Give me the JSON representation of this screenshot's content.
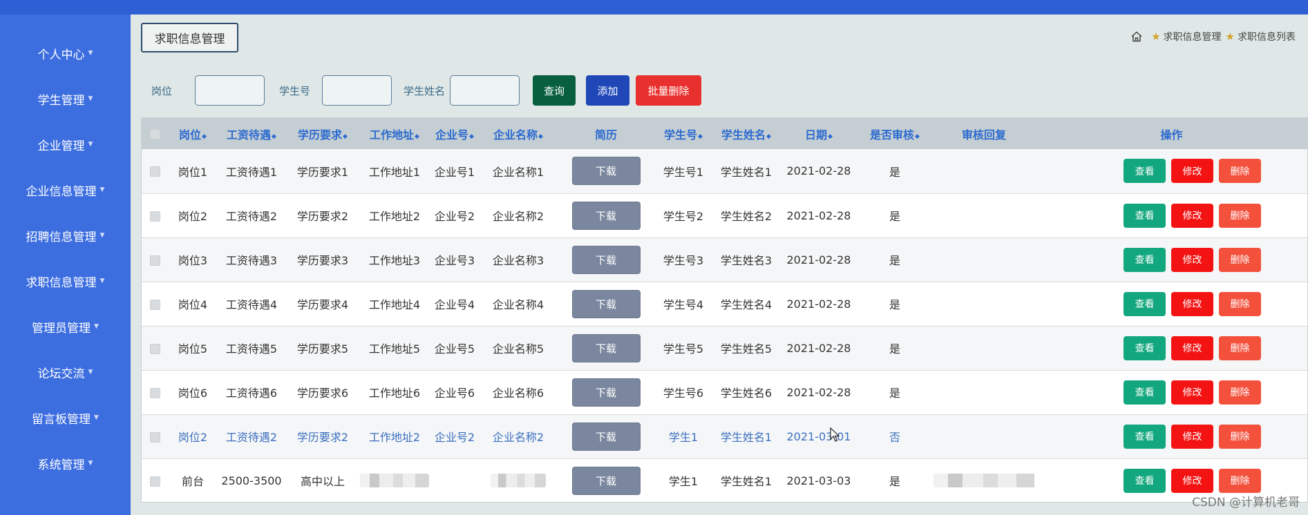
{
  "sidebar": {
    "items": [
      {
        "label": "个人中心"
      },
      {
        "label": "学生管理"
      },
      {
        "label": "企业管理"
      },
      {
        "label": "企业信息管理"
      },
      {
        "label": "招聘信息管理"
      },
      {
        "label": "求职信息管理"
      },
      {
        "label": "管理员管理"
      },
      {
        "label": "论坛交流"
      },
      {
        "label": "留言板管理"
      },
      {
        "label": "系统管理"
      }
    ]
  },
  "header": {
    "title": "求职信息管理",
    "breadcrumb": [
      "求职信息管理",
      "求职信息列表"
    ]
  },
  "search": {
    "label_position": "岗位",
    "label_student_no": "学生号",
    "label_student_name": "学生姓名",
    "value_position": "",
    "value_student_no": "",
    "value_student_name": "",
    "query_label": "查询",
    "add_label": "添加",
    "batch_delete_label": "批量删除"
  },
  "table": {
    "headers": [
      "岗位",
      "工资待遇",
      "学历要求",
      "工作地址",
      "企业号",
      "企业名称",
      "简历",
      "学生号",
      "学生姓名",
      "日期",
      "是否审核",
      "审核回复",
      "操作"
    ],
    "download_label": "下载",
    "view_label": "查看",
    "edit_label": "修改",
    "delete_label": "删除",
    "rows": [
      {
        "position": "岗位1",
        "salary": "工资待遇1",
        "education": "学历要求1",
        "address": "工作地址1",
        "company_no": "企业号1",
        "company_name": "企业名称1",
        "student_no": "学生号1",
        "student_name": "学生姓名1",
        "date": "2021-02-28",
        "reviewed": "是",
        "reply": ""
      },
      {
        "position": "岗位2",
        "salary": "工资待遇2",
        "education": "学历要求2",
        "address": "工作地址2",
        "company_no": "企业号2",
        "company_name": "企业名称2",
        "student_no": "学生号2",
        "student_name": "学生姓名2",
        "date": "2021-02-28",
        "reviewed": "是",
        "reply": ""
      },
      {
        "position": "岗位3",
        "salary": "工资待遇3",
        "education": "学历要求3",
        "address": "工作地址3",
        "company_no": "企业号3",
        "company_name": "企业名称3",
        "student_no": "学生号3",
        "student_name": "学生姓名3",
        "date": "2021-02-28",
        "reviewed": "是",
        "reply": ""
      },
      {
        "position": "岗位4",
        "salary": "工资待遇4",
        "education": "学历要求4",
        "address": "工作地址4",
        "company_no": "企业号4",
        "company_name": "企业名称4",
        "student_no": "学生号4",
        "student_name": "学生姓名4",
        "date": "2021-02-28",
        "reviewed": "是",
        "reply": ""
      },
      {
        "position": "岗位5",
        "salary": "工资待遇5",
        "education": "学历要求5",
        "address": "工作地址5",
        "company_no": "企业号5",
        "company_name": "企业名称5",
        "student_no": "学生号5",
        "student_name": "学生姓名5",
        "date": "2021-02-28",
        "reviewed": "是",
        "reply": ""
      },
      {
        "position": "岗位6",
        "salary": "工资待遇6",
        "education": "学历要求6",
        "address": "工作地址6",
        "company_no": "企业号6",
        "company_name": "企业名称6",
        "student_no": "学生号6",
        "student_name": "学生姓名6",
        "date": "2021-02-28",
        "reviewed": "是",
        "reply": ""
      },
      {
        "position": "岗位2",
        "salary": "工资待遇2",
        "education": "学历要求2",
        "address": "工作地址2",
        "company_no": "企业号2",
        "company_name": "企业名称2",
        "student_no": "学生1",
        "student_name": "学生姓名1",
        "date": "2021-03-01",
        "reviewed": "否",
        "reply": ""
      },
      {
        "position": "前台",
        "salary": "2500-3500",
        "education": "高中以上",
        "address": "",
        "company_no": "",
        "company_name": "",
        "student_no": "学生1",
        "student_name": "学生姓名1",
        "date": "2021-03-03",
        "reviewed": "是",
        "reply": ""
      }
    ]
  },
  "watermark": "CSDN @计算机老哥",
  "colors": {
    "sidebar": "#3d6ee0",
    "topbar": "#2e5fd4",
    "query": "#075f3f",
    "add": "#1f47b8",
    "batch_delete": "#e8302e",
    "view": "#12a77e",
    "edit": "#f41313",
    "delete": "#f4513d",
    "header_text": "#2b6ad0"
  },
  "icons": {
    "home": "home-icon",
    "breadcrumb_separator": "star-icon",
    "sort": "sort-icon",
    "dropdown": "caret-down-icon"
  }
}
